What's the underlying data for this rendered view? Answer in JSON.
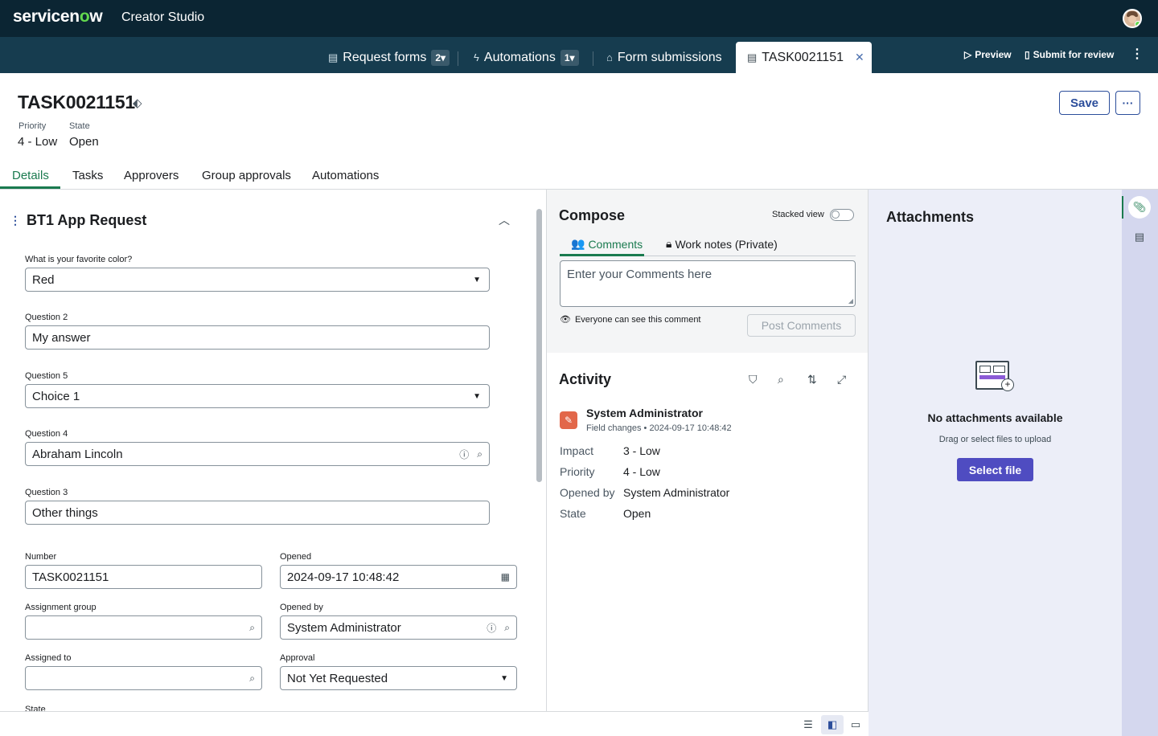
{
  "topbar": {
    "brand_pre": "servicen",
    "brand_o": "o",
    "brand_post": "w",
    "product": "Creator Studio"
  },
  "tabbar": {
    "tabs": [
      {
        "label": "Request forms",
        "count": "2▾",
        "icon": "form-icon"
      },
      {
        "label": "Automations",
        "count": "1▾",
        "icon": "automation-icon"
      },
      {
        "label": "Form submissions",
        "icon": "inbox-icon"
      },
      {
        "label": "TASK0021151",
        "icon": "form-icon",
        "active": true
      }
    ],
    "preview": "Preview",
    "submit": "Submit for review"
  },
  "record": {
    "title": "TASK0021151",
    "priority_label": "Priority",
    "priority_value": "4 - Low",
    "state_label": "State",
    "state_value": "Open",
    "save": "Save",
    "tabs": [
      "Details",
      "Tasks",
      "Approvers",
      "Group approvals",
      "Automations"
    ]
  },
  "form": {
    "section_title": "BT1 App Request",
    "fields": [
      {
        "label": "What is your favorite color?",
        "value": "Red",
        "type": "select"
      },
      {
        "label": "Question 2",
        "value": "My answer",
        "type": "text"
      },
      {
        "label": "Question 5",
        "value": "Choice 1",
        "type": "select"
      },
      {
        "label": "Question 4",
        "value": "Abraham Lincoln",
        "type": "reference"
      },
      {
        "label": "Question 3",
        "value": "Other things",
        "type": "text"
      }
    ],
    "number_label": "Number",
    "number_value": "TASK0021151",
    "opened_label": "Opened",
    "opened_value": "2024-09-17 10:48:42",
    "assignment_group_label": "Assignment group",
    "assignment_group_value": "",
    "opened_by_label": "Opened by",
    "opened_by_value": "System Administrator",
    "assigned_to_label": "Assigned to",
    "assigned_to_value": "",
    "approval_label": "Approval",
    "approval_value": "Not Yet Requested",
    "state_label": "State"
  },
  "compose": {
    "title": "Compose",
    "stacked_view": "Stacked view",
    "tab_comments": "Comments",
    "tab_worknotes": "Work notes (Private)",
    "placeholder": "Enter your Comments here",
    "visibility_note": "Everyone can see this comment",
    "post": "Post Comments"
  },
  "activity": {
    "title": "Activity",
    "entry": {
      "author": "System Administrator",
      "type": "Field changes",
      "timestamp": "2024-09-17 10:48:42",
      "changes": [
        {
          "field": "Impact",
          "value": "3 - Low"
        },
        {
          "field": "Priority",
          "value": "4 - Low"
        },
        {
          "field": "Opened by",
          "value": "System Administrator"
        },
        {
          "field": "State",
          "value": "Open"
        }
      ]
    }
  },
  "attachments": {
    "title": "Attachments",
    "empty": "No attachments available",
    "hint": "Drag or select files to upload",
    "select": "Select file"
  },
  "colors": {
    "topbar": "#0b2533",
    "tabbar": "#163c4f",
    "accent_green": "#1a7a4f",
    "primary_blue": "#2c4e9b",
    "upload_button": "#4f4cc1"
  }
}
